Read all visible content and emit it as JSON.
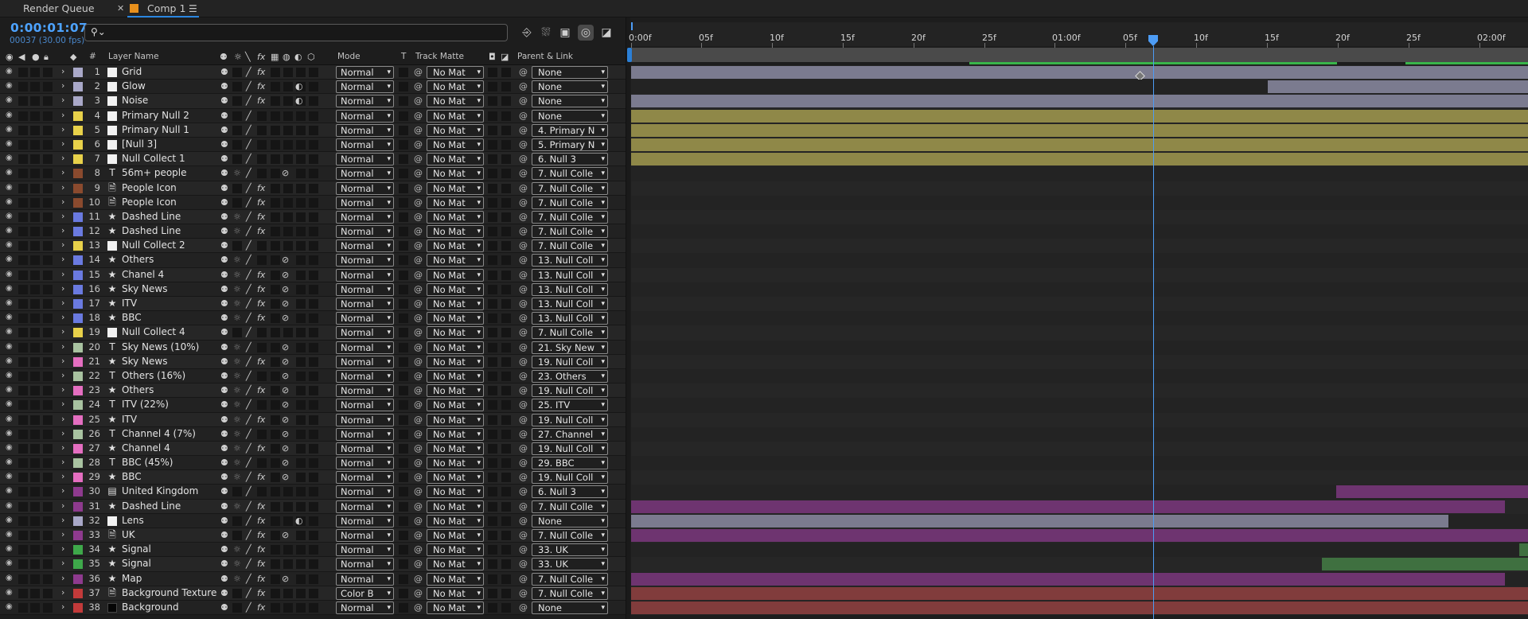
{
  "tabs": [
    {
      "label": "Render Queue"
    },
    {
      "label": "Comp 1",
      "active": true,
      "swatch_color": "#e8901c"
    }
  ],
  "header": {
    "timecode": "0:00:01:07",
    "frames": "00037 (30.00 fps)",
    "search_placeholder": ""
  },
  "columns": {
    "layer_name": "Layer Name",
    "hash": "#",
    "mode": "Mode",
    "t": "T",
    "track_matte": "Track Matte",
    "parent_link": "Parent & Link"
  },
  "ruler": {
    "labels": [
      "0:00f",
      "05f",
      "10f",
      "15f",
      "20f",
      "25f",
      "01:00f",
      "05f",
      "10f",
      "15f",
      "20f",
      "25f",
      "02:00f"
    ]
  },
  "layers": [
    {
      "num": "1",
      "name": "Grid",
      "type": "solid",
      "label_color": "#a9a8c8",
      "mode": "Normal",
      "matte": "No Mat",
      "parent": "None",
      "fx": true,
      "bar": "#7b7b8f"
    },
    {
      "num": "2",
      "name": "Glow",
      "type": "solid",
      "label_color": "#a9a8c8",
      "mode": "Normal",
      "matte": "No Mat",
      "parent": "None",
      "fx": true,
      "bar": "#7b7b8f"
    },
    {
      "num": "3",
      "name": "Noise",
      "type": "solid",
      "label_color": "#a9a8c8",
      "mode": "Normal",
      "matte": "No Mat",
      "parent": "None",
      "fx": true,
      "bar": "#7b7b8f"
    },
    {
      "num": "4",
      "name": "Primary Null 2",
      "type": "solid",
      "label_color": "#e8d14a",
      "mode": "Normal",
      "matte": "No Mat",
      "parent": "None",
      "fx": false,
      "bar": "#8f8848"
    },
    {
      "num": "5",
      "name": "Primary Null 1",
      "type": "solid",
      "label_color": "#e8d14a",
      "mode": "Normal",
      "matte": "No Mat",
      "parent": "4. Primary N",
      "fx": false,
      "bar": "#8f8848"
    },
    {
      "num": "6",
      "name": "[Null 3]",
      "type": "solid",
      "label_color": "#e8d14a",
      "mode": "Normal",
      "matte": "No Mat",
      "parent": "5. Primary N",
      "fx": false,
      "bar": "#8f8848"
    },
    {
      "num": "7",
      "name": "Null Collect  1",
      "type": "solid",
      "label_color": "#e8d14a",
      "mode": "Normal",
      "matte": "No Mat",
      "parent": "6. Null 3",
      "fx": false,
      "bar": "#8f8848"
    },
    {
      "num": "8",
      "name": "56m+ people",
      "type": "text",
      "label_color": "#8a4a2e",
      "mode": "Normal",
      "matte": "No Mat",
      "parent": "7. Null Colle",
      "fx": false,
      "bar": ""
    },
    {
      "num": "9",
      "name": "People Icon",
      "type": "file",
      "label_color": "#8a4a2e",
      "mode": "Normal",
      "matte": "No Mat",
      "parent": "7. Null Colle",
      "fx": true,
      "bar": ""
    },
    {
      "num": "10",
      "name": "People Icon",
      "type": "file",
      "label_color": "#8a4a2e",
      "mode": "Normal",
      "matte": "No Mat",
      "parent": "7. Null Colle",
      "fx": true,
      "bar": ""
    },
    {
      "num": "11",
      "name": "Dashed Line",
      "type": "shape",
      "label_color": "#6a7ae0",
      "mode": "Normal",
      "matte": "No Mat",
      "parent": "7. Null Colle",
      "fx": true,
      "bar": ""
    },
    {
      "num": "12",
      "name": "Dashed Line",
      "type": "shape",
      "label_color": "#6a7ae0",
      "mode": "Normal",
      "matte": "No Mat",
      "parent": "7. Null Colle",
      "fx": true,
      "bar": ""
    },
    {
      "num": "13",
      "name": "Null Collect  2",
      "type": "solid",
      "label_color": "#e8d14a",
      "mode": "Normal",
      "matte": "No Mat",
      "parent": "7. Null Colle",
      "fx": false,
      "bar": ""
    },
    {
      "num": "14",
      "name": "Others",
      "type": "shape",
      "label_color": "#6a7ae0",
      "mode": "Normal",
      "matte": "No Mat",
      "parent": "13. Null Coll",
      "fx": false,
      "bar": ""
    },
    {
      "num": "15",
      "name": "Chanel 4",
      "type": "shape",
      "label_color": "#6a7ae0",
      "mode": "Normal",
      "matte": "No Mat",
      "parent": "13. Null Coll",
      "fx": true,
      "bar": ""
    },
    {
      "num": "16",
      "name": "Sky News",
      "type": "shape",
      "label_color": "#6a7ae0",
      "mode": "Normal",
      "matte": "No Mat",
      "parent": "13. Null Coll",
      "fx": true,
      "bar": ""
    },
    {
      "num": "17",
      "name": "ITV",
      "type": "shape",
      "label_color": "#6a7ae0",
      "mode": "Normal",
      "matte": "No Mat",
      "parent": "13. Null Coll",
      "fx": true,
      "bar": ""
    },
    {
      "num": "18",
      "name": "BBC",
      "type": "shape",
      "label_color": "#6a7ae0",
      "mode": "Normal",
      "matte": "No Mat",
      "parent": "13. Null Coll",
      "fx": true,
      "bar": ""
    },
    {
      "num": "19",
      "name": "Null Collect  4",
      "type": "solid",
      "label_color": "#e8d14a",
      "mode": "Normal",
      "matte": "No Mat",
      "parent": "7. Null Colle",
      "fx": false,
      "bar": ""
    },
    {
      "num": "20",
      "name": "Sky News (10%)",
      "type": "text",
      "label_color": "#a8c2a0",
      "mode": "Normal",
      "matte": "No Mat",
      "parent": "21. Sky New",
      "fx": false,
      "bar": ""
    },
    {
      "num": "21",
      "name": "Sky News",
      "type": "shape",
      "label_color": "#e46ec0",
      "mode": "Normal",
      "matte": "No Mat",
      "parent": "19. Null Coll",
      "fx": true,
      "bar": ""
    },
    {
      "num": "22",
      "name": "Others (16%)",
      "type": "text",
      "label_color": "#a8c2a0",
      "mode": "Normal",
      "matte": "No Mat",
      "parent": "23. Others",
      "fx": false,
      "bar": ""
    },
    {
      "num": "23",
      "name": "Others",
      "type": "shape",
      "label_color": "#e46ec0",
      "mode": "Normal",
      "matte": "No Mat",
      "parent": "19. Null Coll",
      "fx": true,
      "bar": ""
    },
    {
      "num": "24",
      "name": "ITV (22%)",
      "type": "text",
      "label_color": "#a8c2a0",
      "mode": "Normal",
      "matte": "No Mat",
      "parent": "25. ITV",
      "fx": false,
      "bar": ""
    },
    {
      "num": "25",
      "name": "ITV",
      "type": "shape",
      "label_color": "#e46ec0",
      "mode": "Normal",
      "matte": "No Mat",
      "parent": "19. Null Coll",
      "fx": true,
      "bar": ""
    },
    {
      "num": "26",
      "name": "Channel 4 (7%)",
      "type": "text",
      "label_color": "#a8c2a0",
      "mode": "Normal",
      "matte": "No Mat",
      "parent": "27. Channel",
      "fx": false,
      "bar": ""
    },
    {
      "num": "27",
      "name": "Channel 4",
      "type": "shape",
      "label_color": "#e46ec0",
      "mode": "Normal",
      "matte": "No Mat",
      "parent": "19. Null Coll",
      "fx": true,
      "bar": ""
    },
    {
      "num": "28",
      "name": "BBC (45%)",
      "type": "text",
      "label_color": "#a8c2a0",
      "mode": "Normal",
      "matte": "No Mat",
      "parent": "29. BBC",
      "fx": false,
      "bar": ""
    },
    {
      "num": "29",
      "name": "BBC",
      "type": "shape",
      "label_color": "#e46ec0",
      "mode": "Normal",
      "matte": "No Mat",
      "parent": "19. Null Coll",
      "fx": true,
      "bar": ""
    },
    {
      "num": "30",
      "name": "United Kingdom",
      "type": "comp",
      "label_color": "#8e3a8e",
      "mode": "Normal",
      "matte": "No Mat",
      "parent": "6. Null 3",
      "fx": false,
      "bar": "#6e3470"
    },
    {
      "num": "31",
      "name": "Dashed Line",
      "type": "shape",
      "label_color": "#8e3a8e",
      "mode": "Normal",
      "matte": "No Mat",
      "parent": "7. Null Colle",
      "fx": true,
      "bar": "#6e3470"
    },
    {
      "num": "32",
      "name": "Lens",
      "type": "solid",
      "label_color": "#a9a8c8",
      "mode": "Normal",
      "matte": "No Mat",
      "parent": "None",
      "fx": true,
      "bar": "#7b7b8f"
    },
    {
      "num": "33",
      "name": "UK",
      "type": "file",
      "label_color": "#8e3a8e",
      "mode": "Normal",
      "matte": "No Mat",
      "parent": "7. Null Colle",
      "fx": true,
      "bar": "#6e3470"
    },
    {
      "num": "34",
      "name": "Signal",
      "type": "shape",
      "label_color": "#3ea84a",
      "mode": "Normal",
      "matte": "No Mat",
      "parent": "33. UK",
      "fx": true,
      "bar": "#3f7040"
    },
    {
      "num": "35",
      "name": "Signal",
      "type": "shape",
      "label_color": "#3ea84a",
      "mode": "Normal",
      "matte": "No Mat",
      "parent": "33. UK",
      "fx": true,
      "bar": "#3f7040"
    },
    {
      "num": "36",
      "name": "Map",
      "type": "shape",
      "label_color": "#8e3a8e",
      "mode": "Normal",
      "matte": "No Mat",
      "parent": "7. Null Colle",
      "fx": true,
      "bar": "#6e3470"
    },
    {
      "num": "37",
      "name": "Background Texture",
      "type": "file",
      "label_color": "#c23a3a",
      "mode": "Color B",
      "matte": "No Mat",
      "parent": "7. Null Colle",
      "fx": true,
      "bar": "#813c3c"
    },
    {
      "num": "38",
      "name": "Background",
      "type": "dark",
      "label_color": "#c23a3a",
      "mode": "Normal",
      "matte": "No Mat",
      "parent": "None",
      "fx": true,
      "bar": "#813c3c"
    }
  ]
}
